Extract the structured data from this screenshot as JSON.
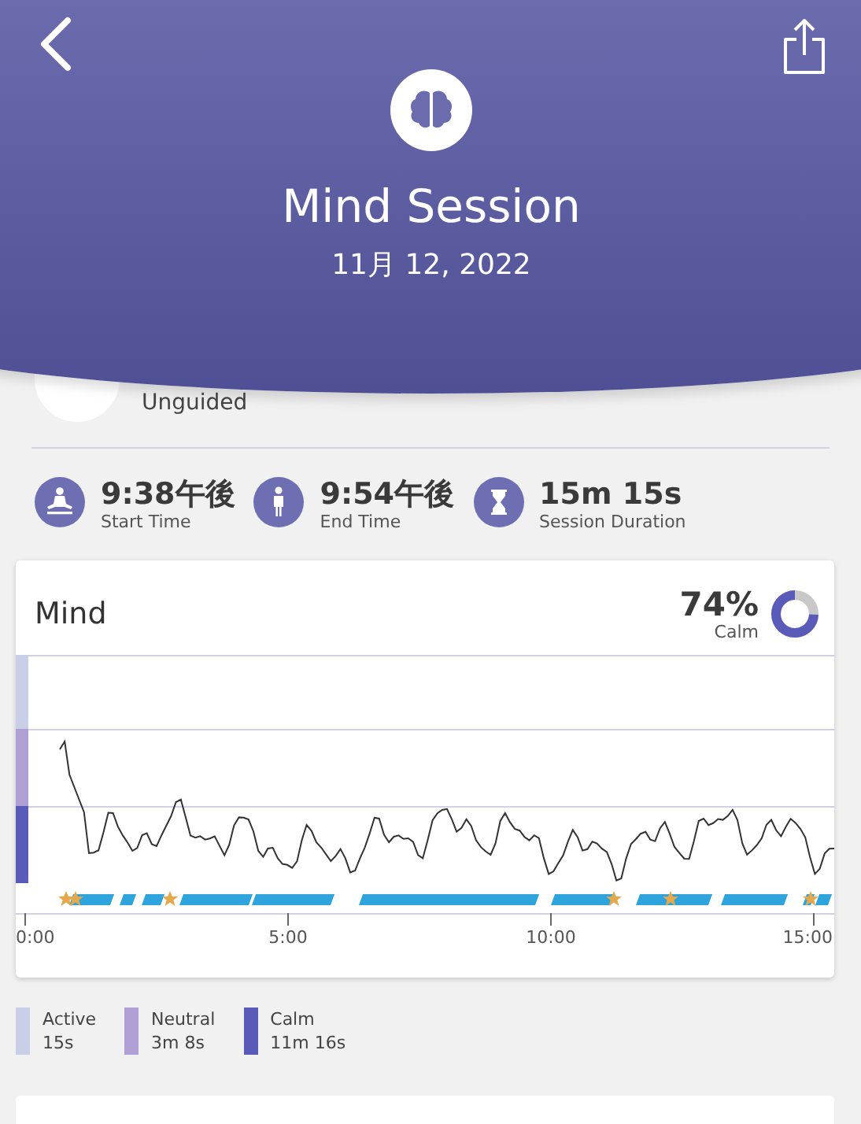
{
  "header": {
    "title": "Mind Session",
    "date": "11月 12, 2022"
  },
  "session": {
    "type": "Unguided"
  },
  "stats": [
    {
      "kind": "meditation",
      "value": "9:38午後",
      "label": "Start Time"
    },
    {
      "kind": "standing",
      "value": "9:54午後",
      "label": "End Time"
    },
    {
      "kind": "hourglass",
      "value": "15m 15s",
      "label": "Session Duration"
    }
  ],
  "card": {
    "title": "Mind",
    "percent": "74%",
    "percent_label": "Calm",
    "x_labels": [
      "0:00",
      "5:00",
      "10:00",
      "15:00"
    ]
  },
  "legend": [
    {
      "name": "Active",
      "duration": "15s",
      "color": "#c9cfe6"
    },
    {
      "name": "Neutral",
      "duration": "3m 8s",
      "color": "#b09fd4"
    },
    {
      "name": "Calm",
      "duration": "11m 16s",
      "color": "#5a5bb8"
    }
  ]
}
